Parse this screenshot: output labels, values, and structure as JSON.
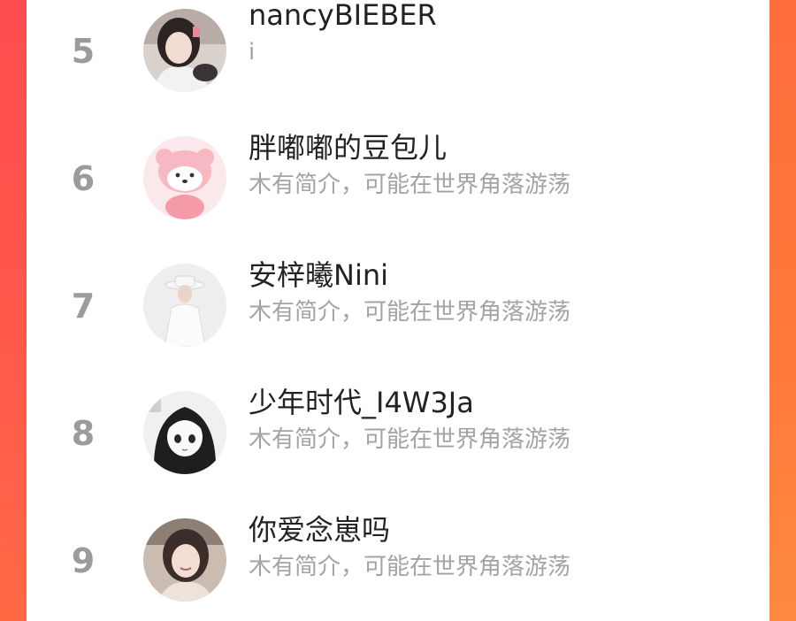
{
  "colors": {
    "accent_left": "#ff4d4f",
    "accent_right": "#ff7a3a",
    "rank_text": "#9b9b9b",
    "name_text": "#222222",
    "bio_text": "#a3a3a3"
  },
  "ranking_list": {
    "items": [
      {
        "rank": "5",
        "name": "nancyBIEBER",
        "bio": "i",
        "avatar": "user-photo-avatar"
      },
      {
        "rank": "6",
        "name": "胖嘟嘟的豆包儿",
        "bio": "木有简介，可能在世界角落游荡",
        "avatar": "pink-bear-avatar"
      },
      {
        "rank": "7",
        "name": "安梓曦Nini",
        "bio": "木有简介，可能在世界角落游荡",
        "avatar": "user-photo-avatar"
      },
      {
        "rank": "8",
        "name": "少年时代_I4W3Ja",
        "bio": "木有简介，可能在世界角落游荡",
        "avatar": "anime-girl-avatar"
      },
      {
        "rank": "9",
        "name": "你爱念崽吗",
        "bio": "木有简介，可能在世界角落游荡",
        "avatar": "user-photo-avatar"
      }
    ]
  }
}
